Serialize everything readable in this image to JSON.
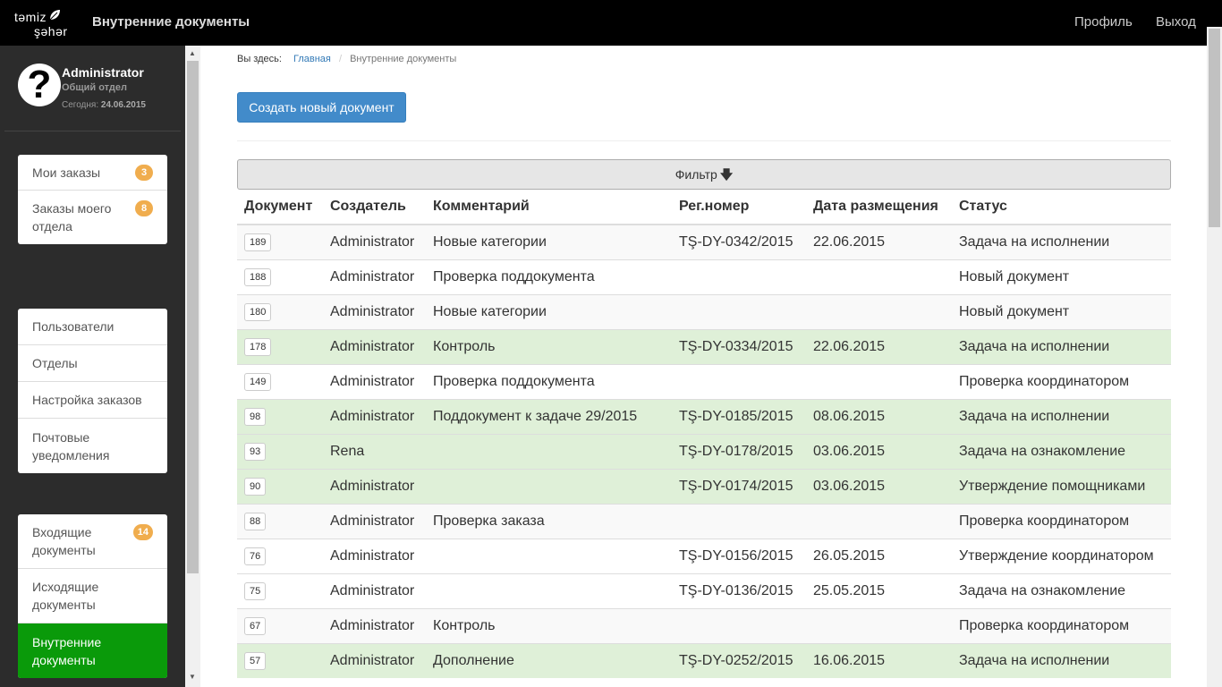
{
  "header": {
    "logo_line1": "təmiz",
    "logo_line2": "şəhər",
    "brand": "Внутренние документы",
    "profile": "Профиль",
    "logout": "Выход"
  },
  "user": {
    "name": "Administrator",
    "dept": "Общий отдел",
    "date_label": "Сегодня:",
    "date": "24.06.2015"
  },
  "sidebar": {
    "group1": [
      {
        "label": "Мои заказы",
        "badge": "3"
      },
      {
        "label": "Заказы моего отдела",
        "badge": "8"
      }
    ],
    "group2": [
      {
        "label": "Пользователи"
      },
      {
        "label": "Отделы"
      },
      {
        "label": "Настройка заказов"
      },
      {
        "label": "Почтовые уведомления"
      }
    ],
    "group3": [
      {
        "label": "Входящие документы",
        "badge": "14"
      },
      {
        "label": "Исходящие документы"
      },
      {
        "label": "Внутренние документы",
        "active": true
      }
    ]
  },
  "breadcrumb": {
    "prefix": "Вы здесь:",
    "home": "Главная",
    "current": "Внутренние документы"
  },
  "create_button": "Создать новый документ",
  "filter": {
    "label": "Фильтр",
    "arrow": "🡇"
  },
  "table": {
    "headers": [
      "Документ",
      "Создатель",
      "Комментарий",
      "Рег.номер",
      "Дата размещения",
      "Статус"
    ],
    "rows": [
      {
        "doc": "189",
        "creator": "Administrator",
        "comment": "Новые категории",
        "reg": "TŞ-DY-0342/2015",
        "date": "22.06.2015",
        "status": "Задача на исполнении",
        "style": "odd"
      },
      {
        "doc": "188",
        "creator": "Administrator",
        "comment": "Проверка поддокумента",
        "reg": "",
        "date": "",
        "status": "Новый документ",
        "style": "plain"
      },
      {
        "doc": "180",
        "creator": "Administrator",
        "comment": "Новые категории",
        "reg": "",
        "date": "",
        "status": "Новый документ",
        "style": "odd"
      },
      {
        "doc": "178",
        "creator": "Administrator",
        "comment": "Контроль",
        "reg": "TŞ-DY-0334/2015",
        "date": "22.06.2015",
        "status": "Задача на исполнении",
        "style": "success"
      },
      {
        "doc": "149",
        "creator": "Administrator",
        "comment": "Проверка поддокумента",
        "reg": "",
        "date": "",
        "status": "Проверка координатором",
        "style": "plain"
      },
      {
        "doc": "98",
        "creator": "Administrator",
        "comment": "Поддокумент к задаче 29/2015",
        "reg": "TŞ-DY-0185/2015",
        "date": "08.06.2015",
        "status": "Задача на исполнении",
        "style": "success"
      },
      {
        "doc": "93",
        "creator": "Rena",
        "comment": "",
        "reg": "TŞ-DY-0178/2015",
        "date": "03.06.2015",
        "status": "Задача на ознакомление",
        "style": "success"
      },
      {
        "doc": "90",
        "creator": "Administrator",
        "comment": "",
        "reg": "TŞ-DY-0174/2015",
        "date": "03.06.2015",
        "status": "Утверждение помощниками",
        "style": "success"
      },
      {
        "doc": "88",
        "creator": "Administrator",
        "comment": "Проверка заказа",
        "reg": "",
        "date": "",
        "status": "Проверка координатором",
        "style": "odd"
      },
      {
        "doc": "76",
        "creator": "Administrator",
        "comment": "",
        "reg": "TŞ-DY-0156/2015",
        "date": "26.05.2015",
        "status": "Утверждение координатором",
        "style": "plain"
      },
      {
        "doc": "75",
        "creator": "Administrator",
        "comment": "",
        "reg": "TŞ-DY-0136/2015",
        "date": "25.05.2015",
        "status": "Задача на ознакомление",
        "style": "plain"
      },
      {
        "doc": "67",
        "creator": "Administrator",
        "comment": "Контроль",
        "reg": "",
        "date": "",
        "status": "Проверка координатором",
        "style": "odd"
      },
      {
        "doc": "57",
        "creator": "Administrator",
        "comment": "Дополнение",
        "reg": "TŞ-DY-0252/2015",
        "date": "16.06.2015",
        "status": "Задача на исполнении",
        "style": "success"
      }
    ]
  },
  "colors": {
    "navbar": "#000000",
    "sidebar": "#2c2c2c",
    "primary": "#428bca",
    "active_green": "#0a9a0a",
    "success_row": "#dff0d8",
    "badge": "#f0ad4e"
  }
}
